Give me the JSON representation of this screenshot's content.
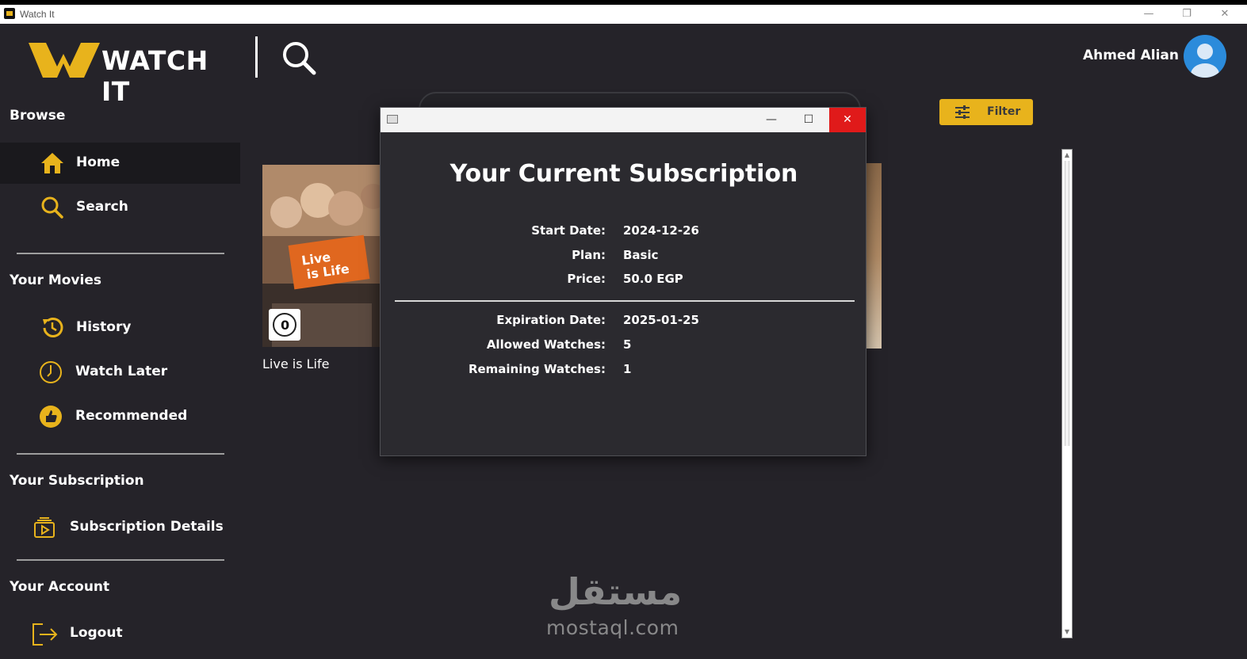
{
  "window": {
    "title": "Watch It",
    "minimize_glyph": "—",
    "restore_glyph": "❐",
    "close_glyph": "✕"
  },
  "header": {
    "brand": "WATCH IT",
    "user_name": "Ahmed Alian"
  },
  "sidebar": {
    "sections": [
      {
        "title": "Browse"
      },
      {
        "title": "Your Movies"
      },
      {
        "title": "Your Subscription"
      },
      {
        "title": "Your Account"
      }
    ],
    "items": [
      {
        "label": "Home",
        "icon": "home-icon",
        "active": true
      },
      {
        "label": "Search",
        "icon": "search-icon"
      },
      {
        "label": "History",
        "icon": "history-icon"
      },
      {
        "label": "Watch Later",
        "icon": "clock-icon"
      },
      {
        "label": "Recommended",
        "icon": "thumbs-up-icon"
      },
      {
        "label": "Subscription Details",
        "icon": "subscription-icon"
      },
      {
        "label": "Logout",
        "icon": "logout-icon"
      }
    ]
  },
  "main": {
    "filter_label": "Filter",
    "movies": [
      {
        "title": "Live is Life",
        "poster_text_1": "Live",
        "poster_text_2": "is Life",
        "rating": "0"
      }
    ]
  },
  "dialog": {
    "title": "Your Current Subscription",
    "fields": [
      {
        "label": "Start Date:",
        "value": "2024-12-26"
      },
      {
        "label": "Plan:",
        "value": "Basic"
      },
      {
        "label": "Price:",
        "value": "50.0 EGP"
      },
      {
        "label": "Expiration Date:",
        "value": "2025-01-25"
      },
      {
        "label": "Allowed Watches:",
        "value": "5"
      },
      {
        "label": "Remaining Watches:",
        "value": "1"
      }
    ],
    "minimize_glyph": "—",
    "maximize_glyph": "☐",
    "close_glyph": "✕"
  },
  "watermark": {
    "arabic": "مستقل",
    "latin": "mostaql.com"
  },
  "colors": {
    "accent": "#e8b31c",
    "background": "#252329",
    "active_nav": "#1a191d",
    "close_red": "#e01a1a"
  }
}
